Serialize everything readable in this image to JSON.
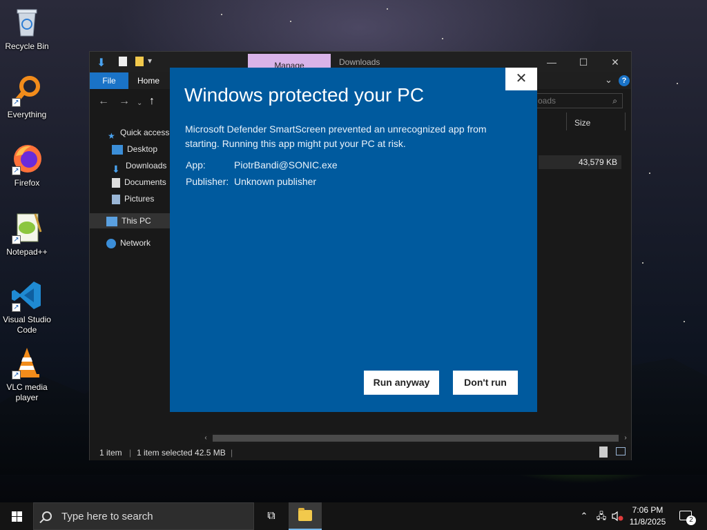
{
  "desktop": {
    "icons": [
      {
        "label": "Recycle Bin"
      },
      {
        "label": "Everything"
      },
      {
        "label": "Firefox"
      },
      {
        "label": "Notepad++"
      },
      {
        "label": "Visual Studio Code"
      },
      {
        "label": "VLC media player"
      }
    ]
  },
  "explorer": {
    "manage_tab": "Manage",
    "title": "Downloads",
    "ribbon": {
      "file": "File",
      "home": "Home"
    },
    "search_placeholder": "oads",
    "nav": {
      "quick_access": "Quick access",
      "desktop": "Desktop",
      "downloads": "Downloads",
      "documents": "Documents",
      "pictures": "Pictures",
      "this_pc": "This PC",
      "network": "Network"
    },
    "columns": {
      "size": "Size"
    },
    "file_size": "43,579 KB",
    "status": {
      "items": "1 item",
      "selected": "1 item selected  42.5 MB"
    }
  },
  "smartscreen": {
    "title": "Windows protected your PC",
    "message": "Microsoft Defender SmartScreen prevented an unrecognized app from starting. Running this app might put your PC at risk.",
    "app_label": "App:",
    "app_value": "PiotrBandi@SONIC.exe",
    "publisher_label": "Publisher:",
    "publisher_value": "Unknown publisher",
    "run_anyway": "Run anyway",
    "dont_run": "Don't run",
    "accent": "#005a9e"
  },
  "taskbar": {
    "search_placeholder": "Type here to search",
    "time": "7:06 PM",
    "date": "11/8/2025",
    "notification_count": "2"
  }
}
